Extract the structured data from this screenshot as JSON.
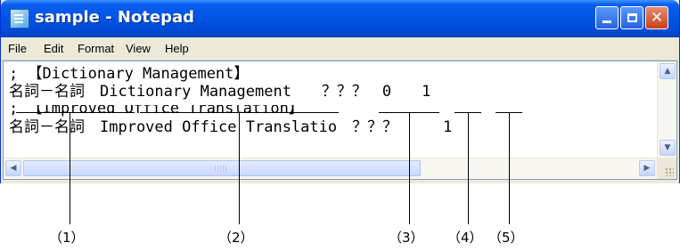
{
  "window": {
    "title": "sample - Notepad",
    "icon": "notepad-icon",
    "buttons": [
      "minimize-icon",
      "maximize-icon",
      "close-icon"
    ]
  },
  "menu": {
    "items": [
      "File",
      "Edit",
      "Format",
      "View",
      "Help"
    ]
  },
  "editor": {
    "lines": [
      "; 【Dictionary Management】",
      "名詞－名詞　Dictionary Management　　？？？　0　　1",
      "; 【Improved Office Translation】",
      "名詞－名詞　Improved Office Translatio　？？？　　　1"
    ]
  },
  "callouts": {
    "labels": [
      "（1）",
      "（2）",
      "（3）",
      "（4）",
      "（5）"
    ]
  },
  "colors": {
    "titlebar": "#0054e3",
    "close_button": "#c9401c",
    "chrome": "#ece9d8"
  }
}
